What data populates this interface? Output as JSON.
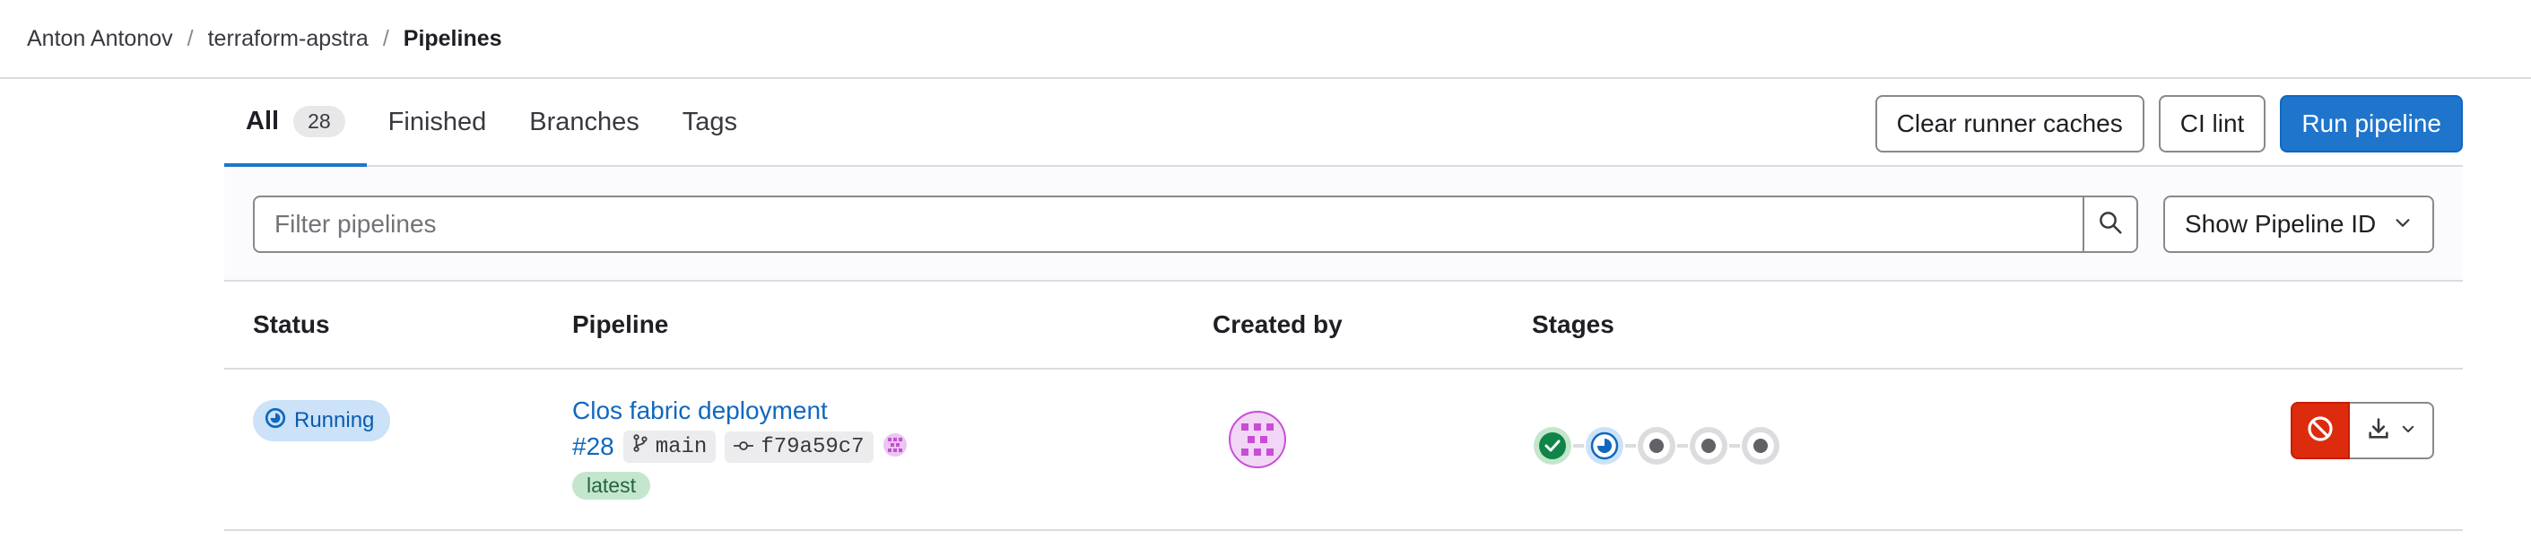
{
  "breadcrumb": {
    "items": [
      "Anton Antonov",
      "terraform-apstra",
      "Pipelines"
    ],
    "separator": "/"
  },
  "tabs": [
    {
      "label": "All",
      "count": "28",
      "active": true
    },
    {
      "label": "Finished"
    },
    {
      "label": "Branches"
    },
    {
      "label": "Tags"
    }
  ],
  "actions": {
    "clear_caches": "Clear runner caches",
    "ci_lint": "CI lint",
    "run_pipeline": "Run pipeline"
  },
  "filter": {
    "placeholder": "Filter pipelines",
    "show_id_label": "Show Pipeline ID"
  },
  "table": {
    "headers": {
      "status": "Status",
      "pipeline": "Pipeline",
      "created_by": "Created by",
      "stages": "Stages"
    },
    "rows": [
      {
        "status": "Running",
        "title": "Clos fabric deployment",
        "id": "#28",
        "branch": "main",
        "commit": "f79a59c7",
        "tag": "latest",
        "stages": [
          "success",
          "running",
          "created",
          "created",
          "created"
        ]
      }
    ]
  },
  "colors": {
    "primary": "#1f75cb",
    "danger": "#dd2b0e",
    "success": "#108548",
    "running_badge": "#cbe2f9",
    "avatar": "#c84dd6"
  },
  "icons": [
    "search-icon",
    "chevron-down-icon",
    "branch-icon",
    "commit-icon",
    "cancel-icon",
    "download-icon",
    "status-running-icon",
    "status-success-icon"
  ]
}
